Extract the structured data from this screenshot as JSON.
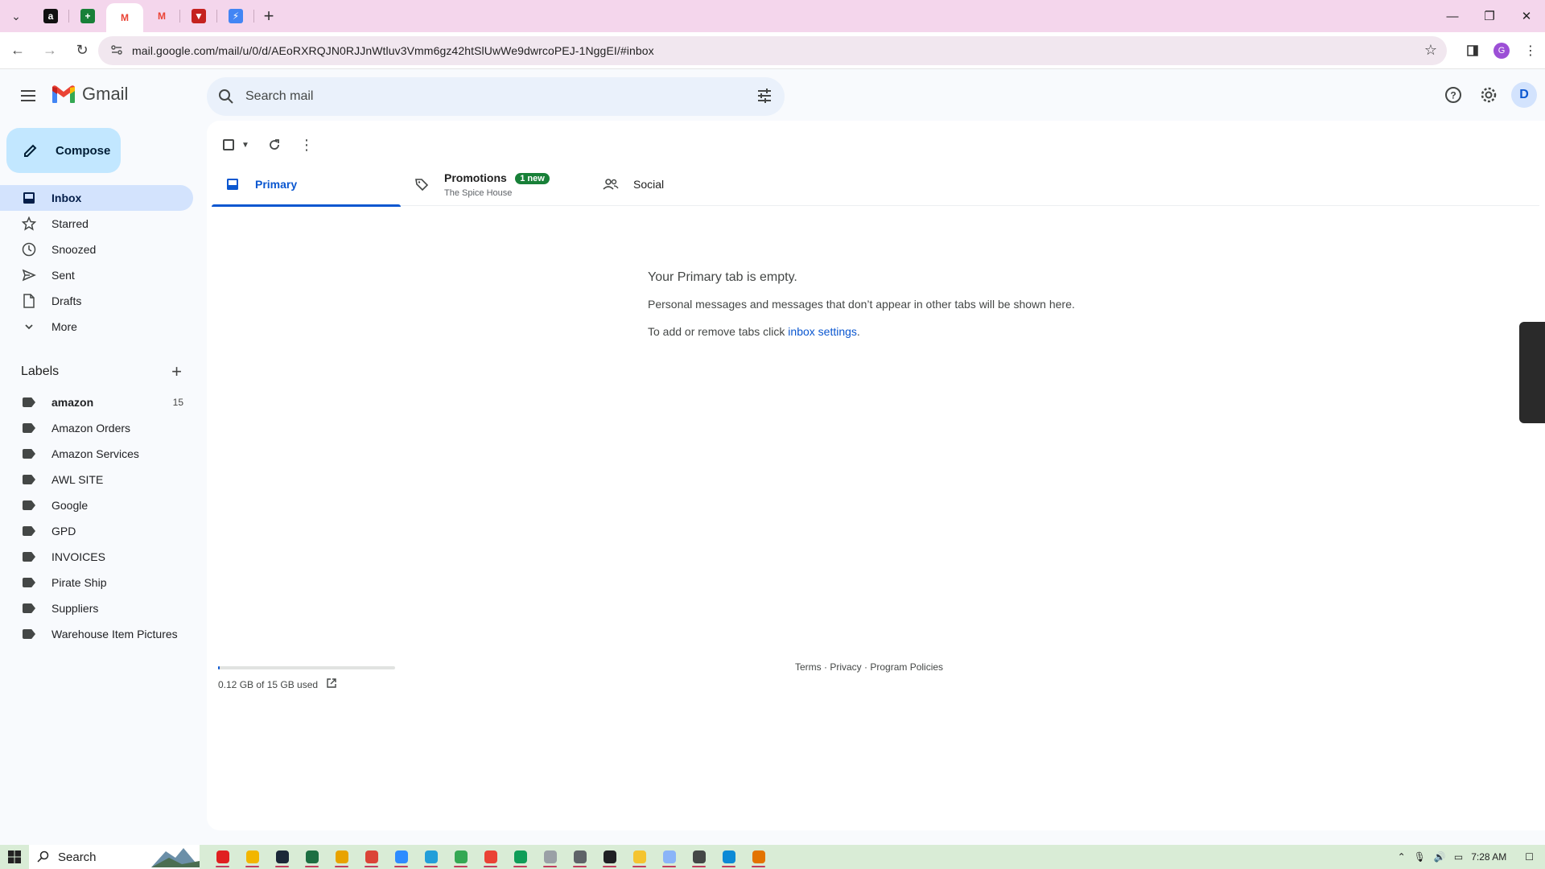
{
  "browser": {
    "tabs": [
      {
        "name": "amazon-tab",
        "glyph": "a",
        "color": "#111111"
      },
      {
        "name": "sheets-tab",
        "glyph": "+",
        "color": "#188038"
      },
      {
        "name": "gmail-tab-active",
        "glyph": "M",
        "color": "#ea4335"
      },
      {
        "name": "gmail-tab-2",
        "glyph": "M",
        "color": "#ea4335"
      },
      {
        "name": "bookmark-tab",
        "glyph": "▼",
        "color": "#c5221f"
      },
      {
        "name": "tools-tab",
        "glyph": "⚡",
        "color": "#4285f4"
      }
    ],
    "url": "mail.google.com/mail/u/0/d/AEoRXRQJN0RJJnWtluv3Vmm6gz42htSlUwWe9dwrcoPEJ-1NggEI/#inbox",
    "profile_initial": "G"
  },
  "gmail": {
    "logo_text": "Gmail",
    "search_placeholder": "Search mail",
    "avatar_initial": "D",
    "compose_label": "Compose",
    "nav": [
      {
        "label": "Inbox",
        "icon": "inbox-icon"
      },
      {
        "label": "Starred",
        "icon": "star-icon"
      },
      {
        "label": "Snoozed",
        "icon": "clock-icon"
      },
      {
        "label": "Sent",
        "icon": "send-icon"
      },
      {
        "label": "Drafts",
        "icon": "draft-icon"
      },
      {
        "label": "More",
        "icon": "chevron-down-icon"
      }
    ],
    "labels_title": "Labels",
    "labels": [
      {
        "label": "amazon",
        "count": "15"
      },
      {
        "label": "Amazon Orders"
      },
      {
        "label": "Amazon Services"
      },
      {
        "label": "AWL SITE"
      },
      {
        "label": "Google"
      },
      {
        "label": "GPD"
      },
      {
        "label": "INVOICES"
      },
      {
        "label": "Pirate Ship"
      },
      {
        "label": "Suppliers"
      },
      {
        "label": "Warehouse Item Pictures"
      }
    ],
    "tabs": {
      "primary": "Primary",
      "promotions": "Promotions",
      "promotions_badge": "1 new",
      "promotions_sub": "The Spice House",
      "social": "Social"
    },
    "empty": {
      "title": "Your Primary tab is empty.",
      "line1": "Personal messages and messages that don’t appear in other tabs will be shown here.",
      "line2_prefix": "To add or remove tabs click ",
      "line2_link": "inbox settings",
      "line2_suffix": "."
    },
    "storage": {
      "text": "0.12 GB of 15 GB used",
      "fraction": 0.008
    },
    "footer": {
      "terms": "Terms",
      "privacy": "Privacy",
      "policies": "Program Policies",
      "sep": " · "
    }
  },
  "taskbar": {
    "search_label": "Search",
    "apps": [
      {
        "name": "record-app",
        "color": "#e02020"
      },
      {
        "name": "file-explorer-app",
        "color": "#f2b600"
      },
      {
        "name": "steam-app",
        "color": "#1b2838"
      },
      {
        "name": "excel-app",
        "color": "#1d6f42"
      },
      {
        "name": "chrome-app-1",
        "color": "#e8a300"
      },
      {
        "name": "chrome-app-2",
        "color": "#db4437"
      },
      {
        "name": "zoom-app",
        "color": "#2d8cff"
      },
      {
        "name": "telegram-app",
        "color": "#229ed9"
      },
      {
        "name": "chrome-app-3",
        "color": "#34a853"
      },
      {
        "name": "chrome-app-4",
        "color": "#ea4335"
      },
      {
        "name": "chrome-app-5",
        "color": "#0f9d58"
      },
      {
        "name": "paint-app",
        "color": "#9aa0a6"
      },
      {
        "name": "calculator-app",
        "color": "#5f6368"
      },
      {
        "name": "obs-app",
        "color": "#202124"
      },
      {
        "name": "sticky-notes-app",
        "color": "#f4c430"
      },
      {
        "name": "notepad-app",
        "color": "#8ab4f8"
      },
      {
        "name": "settings-app",
        "color": "#444746"
      },
      {
        "name": "edge-app",
        "color": "#0c8ad6"
      },
      {
        "name": "tool-app",
        "color": "#e37400"
      }
    ],
    "time": "7:28 AM"
  }
}
